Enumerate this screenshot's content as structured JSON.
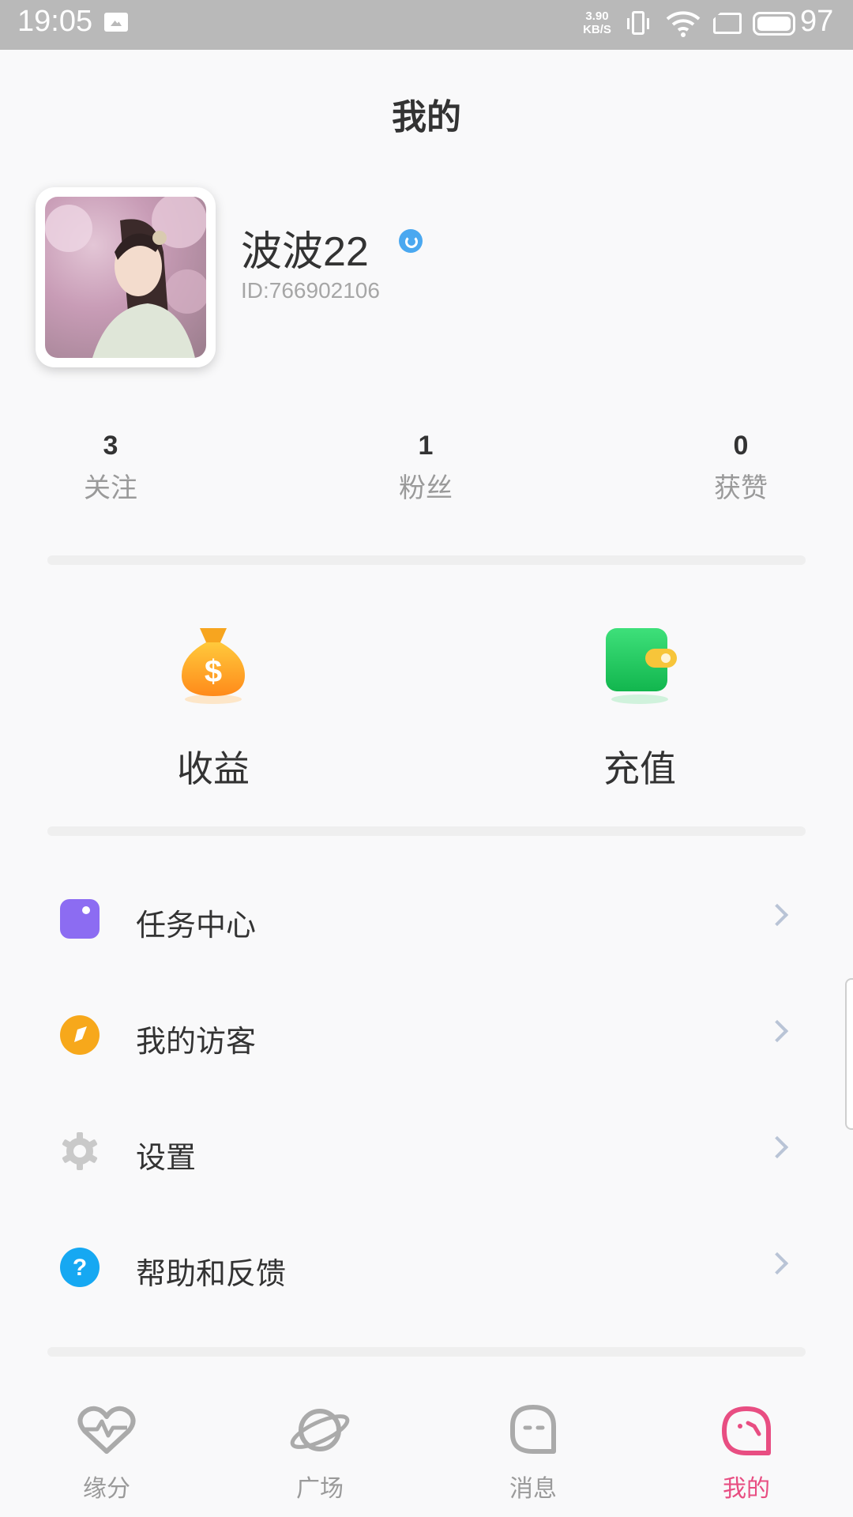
{
  "status_bar": {
    "time": "19:05",
    "speed_value": "3.90",
    "speed_unit": "KB/S",
    "battery_level": "97"
  },
  "header": {
    "title": "我的"
  },
  "profile": {
    "username": "波波22",
    "user_id": "ID:766902106"
  },
  "stats": [
    {
      "value": "3",
      "label": "关注"
    },
    {
      "value": "1",
      "label": "粉丝"
    },
    {
      "value": "0",
      "label": "获赞"
    }
  ],
  "wallet": {
    "earnings_label": "收益",
    "recharge_label": "充值"
  },
  "menu": [
    {
      "label": "任务中心",
      "icon": "task-center-icon",
      "color": "#8c6cf2"
    },
    {
      "label": "我的访客",
      "icon": "visitor-icon",
      "color": "#f7a81b"
    },
    {
      "label": "设置",
      "icon": "gear-icon",
      "color": "#c9c9c9"
    },
    {
      "label": "帮助和反馈",
      "icon": "help-icon",
      "color": "#16a8f2"
    }
  ],
  "bottom_nav": [
    {
      "label": "缘分",
      "icon": "heartbeat-icon"
    },
    {
      "label": "广场",
      "icon": "planet-icon"
    },
    {
      "label": "消息",
      "icon": "message-icon"
    },
    {
      "label": "我的",
      "icon": "profile-face-icon",
      "active": true
    }
  ],
  "colors": {
    "accent": "#e84e82",
    "background": "#f9f9fa"
  }
}
